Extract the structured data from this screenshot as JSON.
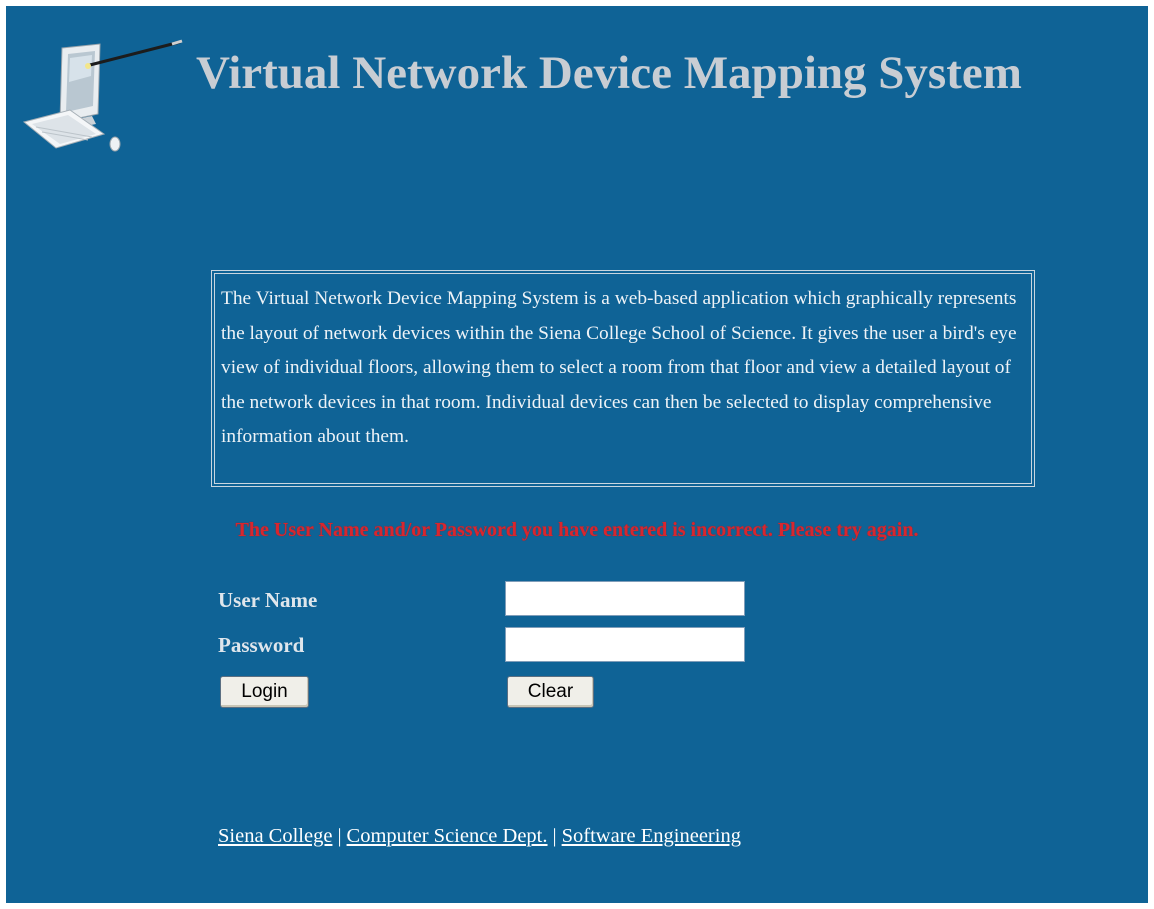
{
  "header": {
    "title": "Virtual Network Device Mapping System",
    "logo_icon": "computer-with-stylus-icon"
  },
  "description": {
    "text": "The Virtual Network Device Mapping System is a web-based application which graphically represents the layout of network devices within the Siena College School of Science. It gives the user a bird's eye view of individual floors, allowing them to select a room from that floor and view a detailed layout of the network devices in that room. Individual devices can then be selected to display comprehensive information about them."
  },
  "error": {
    "message": "The User Name and/or Password you have entered is incorrect. Please try again."
  },
  "login_form": {
    "username_label": "User Name",
    "username_value": "",
    "password_label": "Password",
    "password_value": "",
    "login_button": "Login",
    "clear_button": "Clear"
  },
  "footer": {
    "links": [
      "Siena College",
      "Computer Science Dept.",
      "Software Engineering"
    ],
    "separator": "|"
  },
  "colors": {
    "background": "#0f6396",
    "title": "#c8cdd3",
    "error": "#d8262e"
  }
}
